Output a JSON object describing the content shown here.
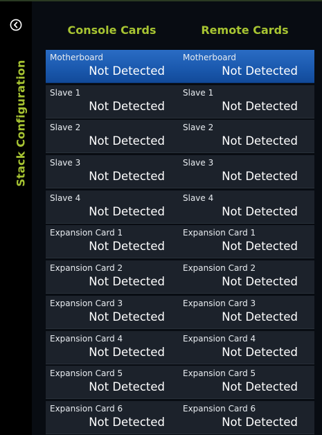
{
  "sidebar": {
    "title": "Stack Configuration",
    "back_icon": "chevron-left-circle-icon"
  },
  "colors": {
    "accent": "#a7c432",
    "selected": "#1a58ad",
    "card_bg": "#1c222b",
    "background": "#080c12"
  },
  "console": {
    "header": "Console Cards",
    "cards": [
      {
        "label": "Motherboard",
        "status": "Not Detected",
        "selected": true
      },
      {
        "label": "Slave 1",
        "status": "Not Detected"
      },
      {
        "label": "Slave 2",
        "status": "Not Detected"
      },
      {
        "label": "Slave 3",
        "status": "Not Detected"
      },
      {
        "label": "Slave 4",
        "status": "Not Detected"
      },
      {
        "label": "Expansion Card 1",
        "status": "Not Detected"
      },
      {
        "label": "Expansion Card 2",
        "status": "Not Detected"
      },
      {
        "label": "Expansion Card 3",
        "status": "Not Detected"
      },
      {
        "label": "Expansion Card 4",
        "status": "Not Detected"
      },
      {
        "label": "Expansion Card 5",
        "status": "Not Detected"
      },
      {
        "label": "Expansion Card 6",
        "status": "Not Detected"
      }
    ]
  },
  "remote": {
    "header": "Remote Cards",
    "cards": [
      {
        "label": "Motherboard",
        "status": "Not Detected",
        "selected": true
      },
      {
        "label": "Slave 1",
        "status": "Not Detected"
      },
      {
        "label": "Slave 2",
        "status": "Not Detected"
      },
      {
        "label": "Slave 3",
        "status": "Not Detected"
      },
      {
        "label": "Slave 4",
        "status": "Not Detected"
      },
      {
        "label": "Expansion Card 1",
        "status": "Not Detected"
      },
      {
        "label": "Expansion Card 2",
        "status": "Not Detected"
      },
      {
        "label": "Expansion Card 3",
        "status": "Not Detected"
      },
      {
        "label": "Expansion Card 4",
        "status": "Not Detected"
      },
      {
        "label": "Expansion Card 5",
        "status": "Not Detected"
      },
      {
        "label": "Expansion Card 6",
        "status": "Not Detected"
      }
    ]
  }
}
